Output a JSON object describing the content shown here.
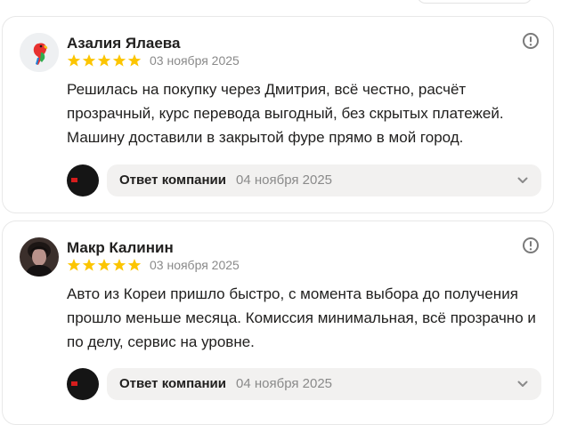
{
  "reviews": [
    {
      "author": "Азалия Ялаева",
      "avatar_icon": "parrot-icon",
      "rating": 5,
      "date": "03 ноября 2025",
      "text": "Решилась на покупку через Дмитрия, всё честно, расчёт прозрачный, курс перевода выгодный, без скрытых платежей. Машину доставили в закрытой фуре прямо в мой город.",
      "reply": {
        "label": "Ответ компании",
        "date": "04 ноября 2025"
      }
    },
    {
      "author": "Макр Калинин",
      "avatar_icon": "user-photo",
      "rating": 5,
      "date": "03 ноября 2025",
      "text": "Авто из Кореи пришло быстро, с момента выбора до получения прошло меньше месяца. Комиссия минимальная, всё прозрачно и по делу, сервис на уровне.",
      "reply": {
        "label": "Ответ компании",
        "date": "04 ноября 2025"
      }
    }
  ],
  "colors": {
    "star": "#fcc500",
    "card_border": "#e8e8e8",
    "reply_bg": "#f2f1f0",
    "muted_text": "#8a8a8a"
  }
}
